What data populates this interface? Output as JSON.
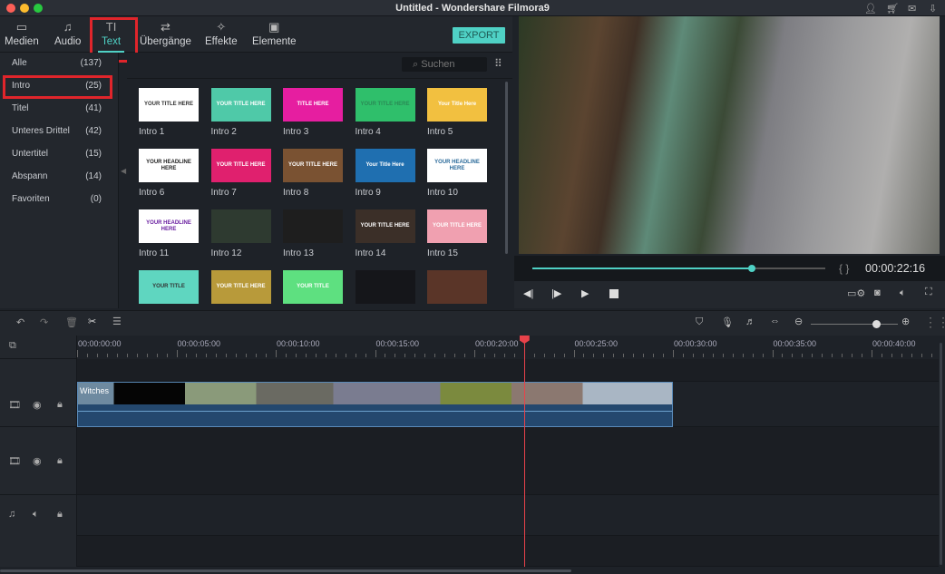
{
  "window": {
    "title": "Untitled - Wondershare Filmora9",
    "controls": [
      "close",
      "minimize",
      "maximize"
    ],
    "icons": [
      "user-icon",
      "cart-icon",
      "mail-icon",
      "download-icon"
    ]
  },
  "toolbar": {
    "tabs": [
      {
        "label": "Medien",
        "icon": "folder-icon"
      },
      {
        "label": "Audio",
        "icon": "music-note-icon"
      },
      {
        "label": "Text",
        "icon": "text-icon",
        "active": true
      },
      {
        "label": "Übergänge",
        "icon": "transition-icon"
      },
      {
        "label": "Effekte",
        "icon": "effects-icon"
      },
      {
        "label": "Elemente",
        "icon": "image-icon"
      }
    ],
    "export_label": "EXPORT",
    "accent": "#4fd1c5",
    "highlight": "#e0252b"
  },
  "sidebar": {
    "categories": [
      {
        "label": "Alle",
        "count": "(137)"
      },
      {
        "label": "Intro",
        "count": "(25)",
        "selected": true
      },
      {
        "label": "Titel",
        "count": "(41)"
      },
      {
        "label": "Unteres Drittel",
        "count": "(42)"
      },
      {
        "label": "Untertitel",
        "count": "(15)"
      },
      {
        "label": "Abspann",
        "count": "(14)"
      },
      {
        "label": "Favoriten",
        "count": "(0)"
      }
    ]
  },
  "search": {
    "placeholder": "Suchen"
  },
  "templates": [
    {
      "label": "Intro 1",
      "text": "YOUR TITLE HERE",
      "bg": "#ffffff",
      "fg": "#333"
    },
    {
      "label": "Intro 2",
      "text": "YOUR TITLE HERE",
      "bg": "#4fc9a8",
      "fg": "#fff"
    },
    {
      "label": "Intro 3",
      "text": "TITLE HERE",
      "bg": "#e61ea0",
      "fg": "#fff"
    },
    {
      "label": "Intro 4",
      "text": "YOUR TITLE HERE",
      "bg": "#2fbf6b",
      "fg": "#2a8a55"
    },
    {
      "label": "Intro 5",
      "text": "Your Title Here",
      "bg": "#f2c040",
      "fg": "#fff"
    },
    {
      "label": "Intro 6",
      "text": "YOUR HEADLINE HERE",
      "bg": "#ffffff",
      "fg": "#222"
    },
    {
      "label": "Intro 7",
      "text": "YOUR TITLE HERE",
      "bg": "#e0206e",
      "fg": "#fff"
    },
    {
      "label": "Intro 8",
      "text": "YOUR TITLE HERE",
      "bg": "#7a5232",
      "fg": "#fff"
    },
    {
      "label": "Intro 9",
      "text": "Your Title Here",
      "bg": "#1f6fb0",
      "fg": "#fff"
    },
    {
      "label": "Intro 10",
      "text": "YOUR HEADLINE HERE",
      "bg": "#ffffff",
      "fg": "#2a6a9a"
    },
    {
      "label": "Intro 11",
      "text": "YOUR HEADLINE HERE",
      "bg": "#ffffff",
      "fg": "#6a1fa0"
    },
    {
      "label": "Intro 12",
      "text": "",
      "bg": "#2e3a30",
      "fg": "#c9b77a"
    },
    {
      "label": "Intro 13",
      "text": "",
      "bg": "#1e1e1e",
      "fg": "#c9a860"
    },
    {
      "label": "Intro 14",
      "text": "YOUR TITLE HERE",
      "bg": "#3b2f28",
      "fg": "#fff"
    },
    {
      "label": "Intro 15",
      "text": "YOUR TITLE HERE",
      "bg": "#f0a0b0",
      "fg": "#fff"
    },
    {
      "label": "",
      "text": "YOUR TITLE",
      "bg": "#5fd6c0",
      "fg": "#333"
    },
    {
      "label": "",
      "text": "YOUR TITLE HERE",
      "bg": "#b89a3a",
      "fg": "#fff"
    },
    {
      "label": "",
      "text": "YOUR TITLE",
      "bg": "#5ee080",
      "fg": "#fff"
    },
    {
      "label": "",
      "text": "",
      "bg": "#15161a",
      "fg": "#fff"
    },
    {
      "label": "",
      "text": "",
      "bg": "#5a3528",
      "fg": "#fff"
    }
  ],
  "player": {
    "timecode": "00:00:22:16",
    "progress": 0.75,
    "markers": "{  }"
  },
  "timeline": {
    "ticks": [
      "00:00:00:00",
      "00:00:05:00",
      "00:00:10:00",
      "00:00:15:00",
      "00:00:20:00",
      "00:00:25:00",
      "00:00:30:00",
      "00:00:35:00",
      "00:00:40:00"
    ],
    "playhead_seconds": 22.5,
    "clip_end_seconds": 30,
    "clip_title": "Witches",
    "zoom_level": 0.75
  }
}
